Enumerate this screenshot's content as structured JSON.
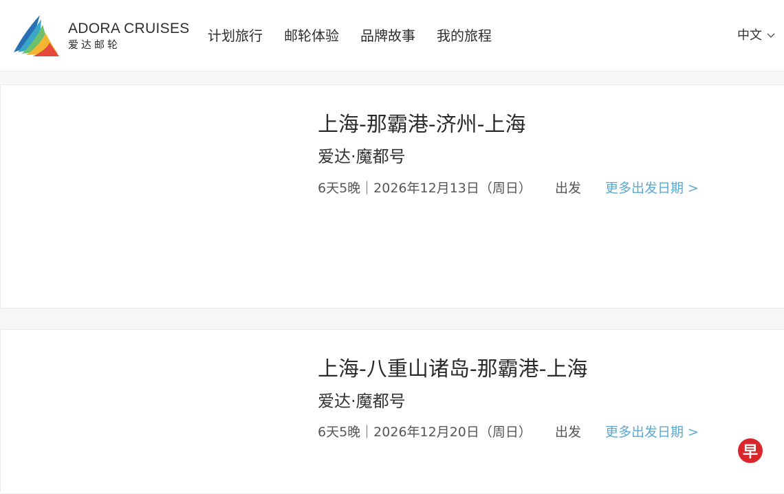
{
  "header": {
    "brand_en": "ADORA CRUISES",
    "brand_zh": "爱达邮轮",
    "nav": [
      "计划旅行",
      "邮轮体验",
      "品牌故事",
      "我的旅程"
    ],
    "language": "中文"
  },
  "cruises": [
    {
      "route": "上海-那霸港-济州-上海",
      "ship": "爱达·魔都号",
      "duration_date": "6天5晚｜2026年12月13日（周日）",
      "depart_label": "出发",
      "more_dates": "更多出发日期 >"
    },
    {
      "route": "上海-八重山诸岛-那霸港-上海",
      "ship": "爱达·魔都号",
      "duration_date": "6天5晚｜2026年12月20日（周日）",
      "depart_label": "出发",
      "more_dates": "更多出发日期 >"
    }
  ],
  "watermark": "早",
  "colors": {
    "accent": "#5aa9d1",
    "badge": "#d9262c"
  }
}
